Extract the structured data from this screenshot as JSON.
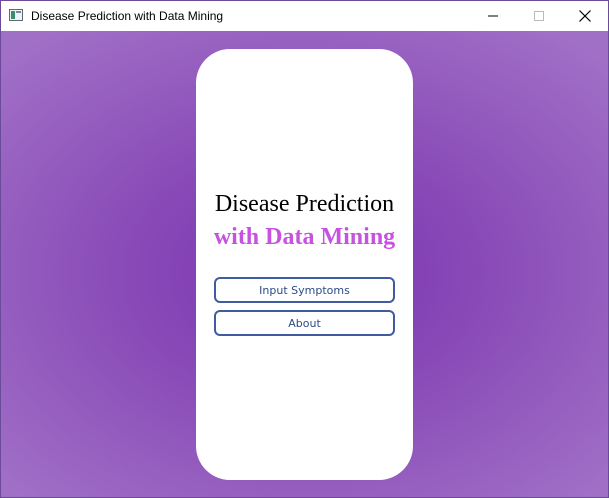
{
  "window": {
    "title": "Disease Prediction with Data Mining",
    "controls": [
      "minimize-icon",
      "maximize-icon",
      "close-icon"
    ]
  },
  "card": {
    "title": "Disease Prediction",
    "subtitle": "with Data Mining",
    "buttons": {
      "input_symptoms": "Input Symptoms",
      "about": "About"
    }
  },
  "colors": {
    "background_center": "#7a33ad",
    "background_edge": "#a06fc6",
    "subtitle": "#c752e0",
    "button_border": "#3f5ca0",
    "button_text": "#2e4a8a"
  }
}
